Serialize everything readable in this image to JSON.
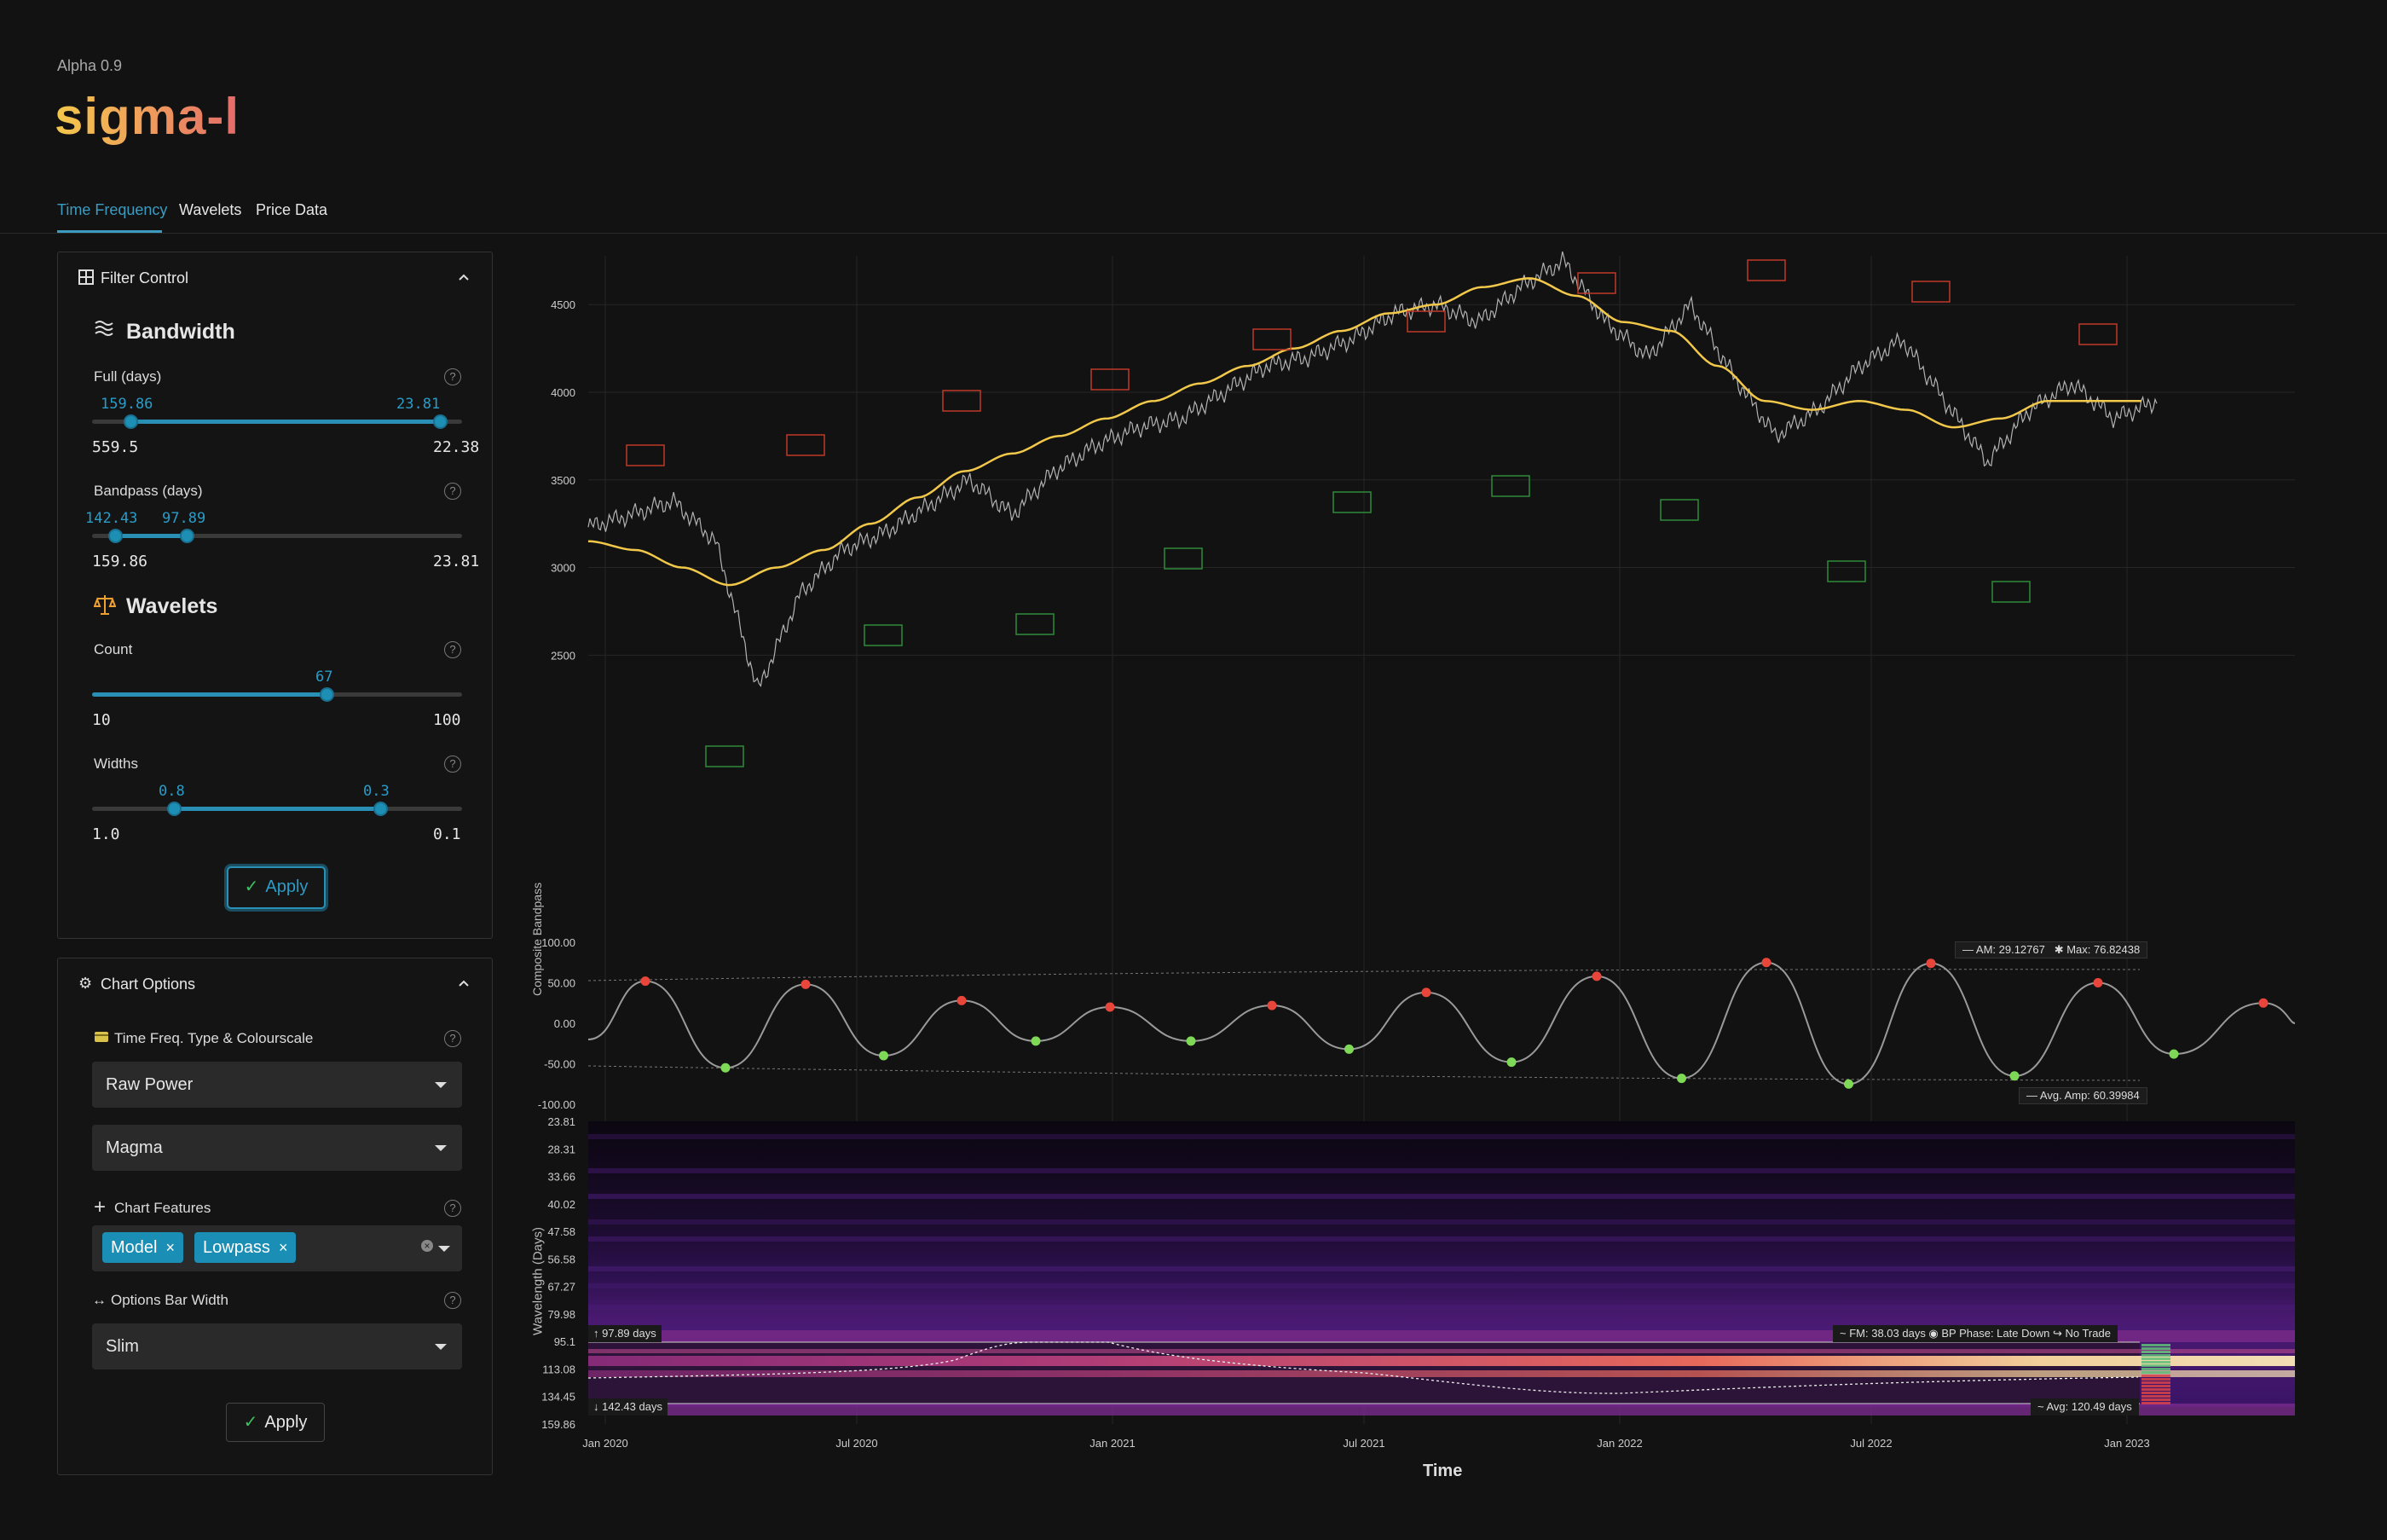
{
  "app": {
    "version": "Alpha 0.9",
    "name": "sigma-l"
  },
  "tabs": [
    {
      "label": "Time Frequency",
      "active": true
    },
    {
      "label": "Wavelets",
      "active": false
    },
    {
      "label": "Price Data",
      "active": false
    }
  ],
  "filter_control": {
    "title": "Filter Control",
    "bandwidth": {
      "title": "Bandwidth",
      "full": {
        "label": "Full (days)",
        "low": "159.86",
        "high": "23.81",
        "min": "559.5",
        "max": "22.38"
      },
      "bandpass": {
        "label": "Bandpass (days)",
        "low": "142.43",
        "high": "97.89",
        "min": "159.86",
        "max": "23.81"
      }
    },
    "wavelets": {
      "title": "Wavelets",
      "count": {
        "label": "Count",
        "value": "67",
        "min": "10",
        "max": "100"
      },
      "widths": {
        "label": "Widths",
        "low": "0.8",
        "high": "0.3",
        "min": "1.0",
        "max": "0.1"
      }
    },
    "apply_label": "Apply"
  },
  "chart_options": {
    "title": "Chart Options",
    "tf_type": {
      "label": "Time Freq. Type & Colourscale",
      "type_value": "Raw Power",
      "colourscale_value": "Magma"
    },
    "features": {
      "label": "Chart Features",
      "tags": [
        "Model",
        "Lowpass"
      ]
    },
    "bar_width": {
      "label": "Options Bar Width",
      "value": "Slim"
    },
    "apply_label": "Apply"
  },
  "chart_data": {
    "type": "line",
    "x_axis": {
      "label": "Time",
      "ticks": [
        "Jan 2020",
        "Jul 2020",
        "Jan 2021",
        "Jul 2021",
        "Jan 2022",
        "Jul 2022",
        "Jan 2023"
      ]
    },
    "price_panel": {
      "y_ticks": [
        "4500",
        "4000",
        "3500",
        "3000",
        "2500"
      ],
      "series": [
        {
          "values": [
            3230,
            3300,
            3380,
            3150,
            2300,
            2850,
            3100,
            3200,
            3350,
            3500,
            3300,
            3550,
            3700,
            3800,
            3850,
            4000,
            4150,
            4200,
            4300,
            4450,
            4500,
            4400,
            4600,
            4750,
            4400,
            4200,
            4500,
            4100,
            3750,
            3900,
            4150,
            4300,
            3950,
            3600,
            3900,
            4050,
            3850,
            3950
          ]
        },
        {
          "values": [
            3150,
            3100,
            3000,
            2900,
            3000,
            3100,
            3250,
            3400,
            3550,
            3650,
            3750,
            3850,
            3950,
            4050,
            4150,
            4250,
            4350,
            4450,
            4500,
            4600,
            4650,
            4550,
            4400,
            4350,
            4150,
            3950,
            3900,
            3950,
            3900,
            3800,
            3850,
            3950,
            3950,
            3950
          ]
        }
      ]
    },
    "bandpass_panel": {
      "ylabel": "Composite Bandpass",
      "y_ticks": [
        "100.00",
        "50.00",
        "0.00",
        "-50.00",
        "-100.00"
      ],
      "peaks": [
        52,
        48,
        28,
        20,
        22,
        38,
        58,
        75,
        74,
        50,
        25
      ],
      "troughs": [
        -55,
        -40,
        -22,
        -22,
        -32,
        -48,
        -68,
        -75,
        -65,
        -38
      ],
      "legend": {
        "am": "AM: 29.12767",
        "max": "Max: 76.82438",
        "avg_amp": "Avg. Amp: 60.39984"
      }
    },
    "tf_panel": {
      "ylabel": "Wavelength (Days)",
      "y_ticks": [
        "23.81",
        "28.31",
        "33.66",
        "40.02",
        "47.58",
        "56.58",
        "67.27",
        "79.98",
        "95.1",
        "113.08",
        "134.45",
        "159.86"
      ],
      "band_top_label": "97.89 days",
      "band_bottom_label": "142.43 days",
      "status": "FM: 38.03 days ◉ BP Phase: Late Down ↪ No Trade",
      "avg": "Avg: 120.49 days"
    }
  },
  "colors": {
    "accent": "#2a8fb4",
    "lowpass": "#f2c84b",
    "peak": "#e8463a",
    "trough": "#7ed957",
    "price": "#cfcfcf"
  }
}
